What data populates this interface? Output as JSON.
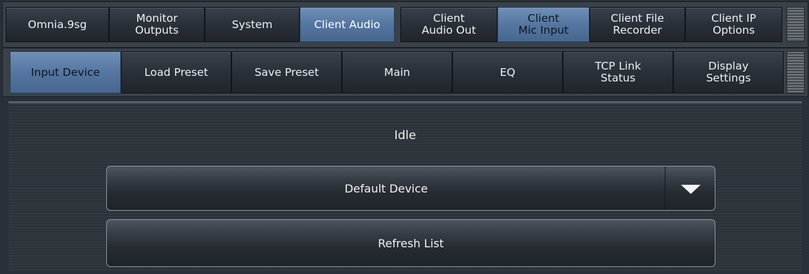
{
  "top_tabs": [
    {
      "label": "Omnia.9sg"
    },
    {
      "label": "Monitor\nOutputs"
    },
    {
      "label": "System"
    },
    {
      "label": "Client Audio",
      "active": true
    }
  ],
  "sub_tabs": [
    {
      "label": "Client\nAudio Out"
    },
    {
      "label": "Client\nMic Input",
      "active": true
    },
    {
      "label": "Client File\nRecorder"
    },
    {
      "label": "Client IP\nOptions"
    }
  ],
  "section_tabs": [
    {
      "label": "Input Device",
      "active": true
    },
    {
      "label": "Load Preset"
    },
    {
      "label": "Save Preset"
    },
    {
      "label": "Main"
    },
    {
      "label": "EQ"
    },
    {
      "label": "TCP Link\nStatus"
    },
    {
      "label": "Display\nSettings"
    }
  ],
  "main": {
    "status": "Idle",
    "device_select": "Default Device",
    "refresh_button": "Refresh List"
  },
  "colors": {
    "accent": "#5a7ba4",
    "background": "#2c3238",
    "text": "#eef1f5"
  },
  "icons": {
    "dropdown": "chevron-down-icon",
    "grip": "menu-grip-icon"
  }
}
